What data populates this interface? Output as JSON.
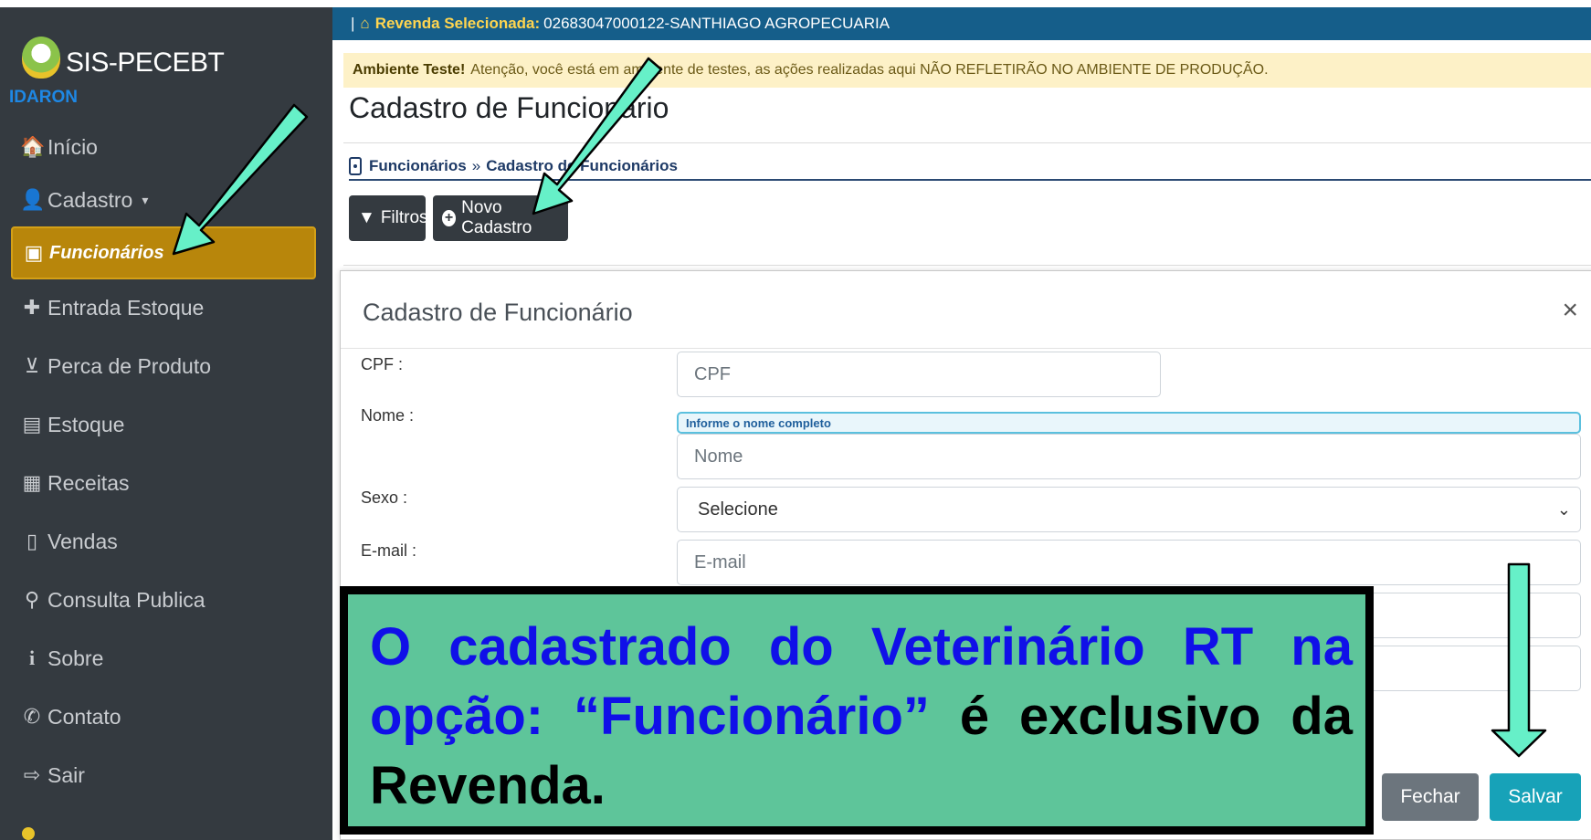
{
  "sidebar": {
    "brand": {
      "title": "SIS-PECEBT",
      "subtitle": "IDARON"
    },
    "items": [
      {
        "label": "Início",
        "icon": "home-icon",
        "glyph": "🏠"
      },
      {
        "label": "Cadastro",
        "icon": "user-icon",
        "glyph": "👤",
        "caret": "▾"
      },
      {
        "label": "Funcionários",
        "icon": "badge-icon",
        "glyph": "▣",
        "active": true
      },
      {
        "label": "Entrada Estoque",
        "icon": "plus-icon",
        "glyph": "✚"
      },
      {
        "label": "Perca de Produto",
        "icon": "inbox-icon",
        "glyph": "⊻"
      },
      {
        "label": "Estoque",
        "icon": "warehouse-icon",
        "glyph": "▤"
      },
      {
        "label": "Receitas",
        "icon": "document-icon",
        "glyph": "▦"
      },
      {
        "label": "Vendas",
        "icon": "file-icon",
        "glyph": "▯"
      },
      {
        "label": "Consulta Publica",
        "icon": "search-icon",
        "glyph": "⚲"
      },
      {
        "label": "Sobre",
        "icon": "info-icon",
        "glyph": "i"
      },
      {
        "label": "Contato",
        "icon": "phone-icon",
        "glyph": "✆"
      },
      {
        "label": "Sair",
        "icon": "sign-out-icon",
        "glyph": "⇨"
      }
    ],
    "active_color": "#b8860b"
  },
  "topbar": {
    "prefix": "|",
    "label": "Revenda Selecionada:",
    "value": "02683047000122-SANTHIAGO AGROPECUARIA",
    "color": "#155e8a"
  },
  "alert": {
    "strong": "Ambiente Teste!",
    "text": "Atenção, você está em ambiente de testes, as ações realizadas aqui NÃO REFLETIRÃO NO AMBIENTE DE PRODUÇÃO."
  },
  "page": {
    "title": "Cadastro de Funcionário",
    "breadcrumb": {
      "first": "Funcionários",
      "separator": "»",
      "second": "Cadastro de Funcionários"
    }
  },
  "toolbar": {
    "filtros": "Filtros",
    "novo": "Novo Cadastro"
  },
  "modal": {
    "title": "Cadastro de Funcionário",
    "close": "×",
    "fields": {
      "cpf": {
        "label": "CPF :",
        "placeholder": "CPF"
      },
      "nome": {
        "label": "Nome :",
        "hint": "Informe o nome completo",
        "placeholder": "Nome"
      },
      "sexo": {
        "label": "Sexo :",
        "value": "Selecione"
      },
      "email": {
        "label": "E-mail :",
        "placeholder": "E-mail"
      }
    },
    "buttons": {
      "fechar": "Fechar",
      "salvar": "Salvar"
    }
  },
  "callout": {
    "part1": "O cadastrado do Veterinário RT na opção: “Funcionário”",
    "part2": " é exclusivo da Revenda.",
    "bg": "#5ec59a",
    "highlight": "#1010e8"
  }
}
